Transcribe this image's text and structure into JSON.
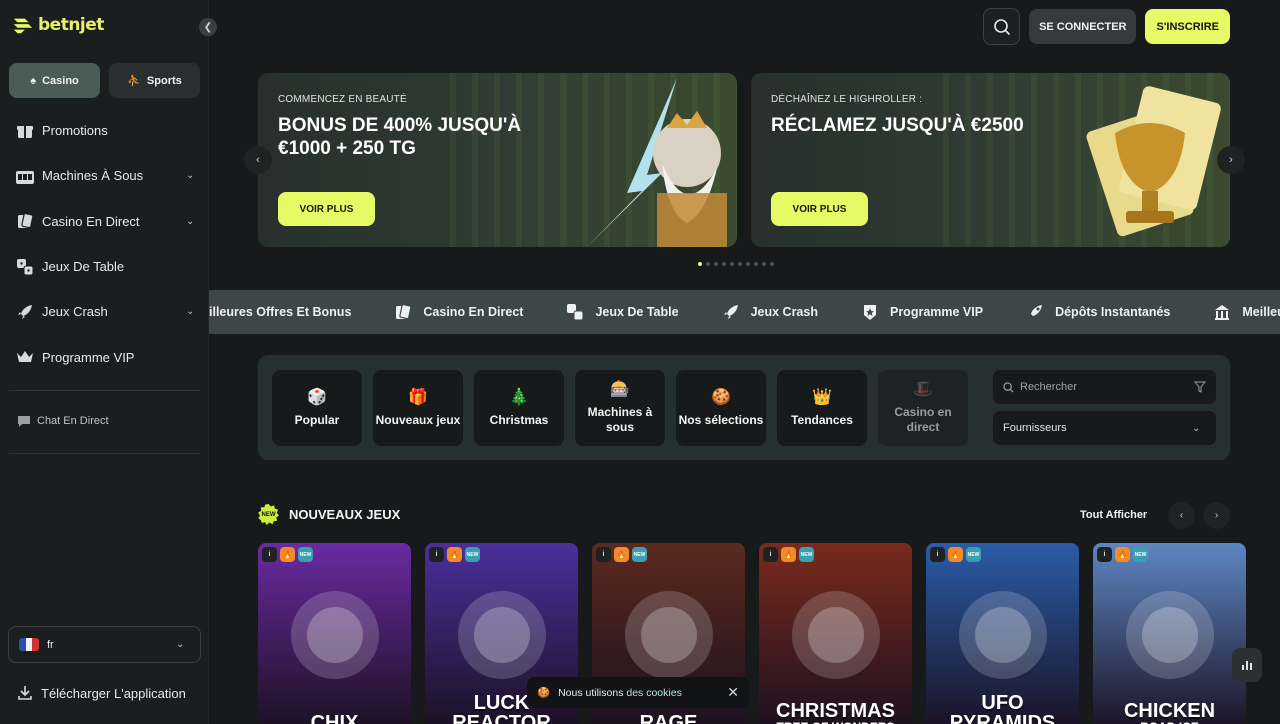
{
  "brand": {
    "name": "betnjet",
    "accent": "#e6fa66"
  },
  "sidebar": {
    "modes": [
      {
        "label": "Casino",
        "icon": "spade-icon"
      },
      {
        "label": "Sports",
        "icon": "basketball-icon"
      }
    ],
    "items": [
      {
        "label": "Promotions",
        "icon": "gift-icon"
      },
      {
        "label": "Machines À Sous",
        "icon": "slot-machine-icon"
      },
      {
        "label": "Casino En Direct",
        "icon": "cards-icon"
      },
      {
        "label": "Jeux De Table",
        "icon": "dice-icon"
      },
      {
        "label": "Jeux Crash",
        "icon": "rocket-icon"
      },
      {
        "label": "Programme VIP",
        "icon": "crown-icon"
      }
    ],
    "chat_label": "Chat En Direct",
    "language": "fr",
    "download_label": "Télécharger L'application"
  },
  "header": {
    "login_label": "SE CONNECTER",
    "signup_label": "S'INSCRIRE"
  },
  "banners": [
    {
      "kicker": "COMMENCEZ EN BEAUTÉ",
      "headline": "BONUS DE 400% JUSQU'À €1000 + 250 TG",
      "cta": "VOIR PLUS"
    },
    {
      "kicker": "DÉCHAÎNEZ LE HIGHROLLER :",
      "headline": "RÉCLAMEZ JUSQU'À €2500",
      "cta": "VOIR PLUS"
    }
  ],
  "carousel": {
    "dot_count": 10,
    "active_index": 0
  },
  "marquee": [
    {
      "label": "illeures Offres Et Bonus",
      "icon": ""
    },
    {
      "label": "Casino En Direct",
      "icon": "cards-icon"
    },
    {
      "label": "Jeux De Table",
      "icon": "dice-icon"
    },
    {
      "label": "Jeux Crash",
      "icon": "rocket-icon"
    },
    {
      "label": "Programme VIP",
      "icon": "star-icon"
    },
    {
      "label": "Dépôts Instantanés",
      "icon": "rocket-icon"
    },
    {
      "label": "Meilleu",
      "icon": "casino-icon"
    }
  ],
  "categories": [
    {
      "label": "Popular",
      "icon": "🎲"
    },
    {
      "label": "Nouveaux jeux",
      "icon": "🎁"
    },
    {
      "label": "Christmas",
      "icon": "🎄"
    },
    {
      "label": "Machines à sous",
      "icon": "🎰"
    },
    {
      "label": "Nos sélections",
      "icon": "🍪"
    },
    {
      "label": "Tendances",
      "icon": "👑"
    },
    {
      "label": "Casino en direct",
      "icon": "🎩"
    }
  ],
  "search": {
    "placeholder": "Rechercher"
  },
  "providers": {
    "label": "Fournisseurs"
  },
  "new_games": {
    "title": "NOUVEAUX JEUX",
    "badge": "NEW",
    "see_all": "Tout Afficher",
    "games": [
      {
        "title": "CHIX",
        "subtitle": "",
        "bg": "#6a2aa0"
      },
      {
        "title": "LUCK REACTOR",
        "subtitle": "",
        "bg": "#4c2f9c"
      },
      {
        "title": "RAGE",
        "subtitle": "",
        "bg": "#5b2a1e"
      },
      {
        "title": "CHRISTMAS",
        "subtitle": "TREE OF WONDERS",
        "bg": "#7a2a1c"
      },
      {
        "title": "UFO PYRAMIDS",
        "subtitle": "",
        "bg": "#2a5ca8"
      },
      {
        "title": "CHICKEN",
        "subtitle": "ROAD ICE",
        "bg": "#5d86c4"
      }
    ]
  },
  "cookie": {
    "text": "Nous utilisons",
    "link": "des cookies"
  }
}
